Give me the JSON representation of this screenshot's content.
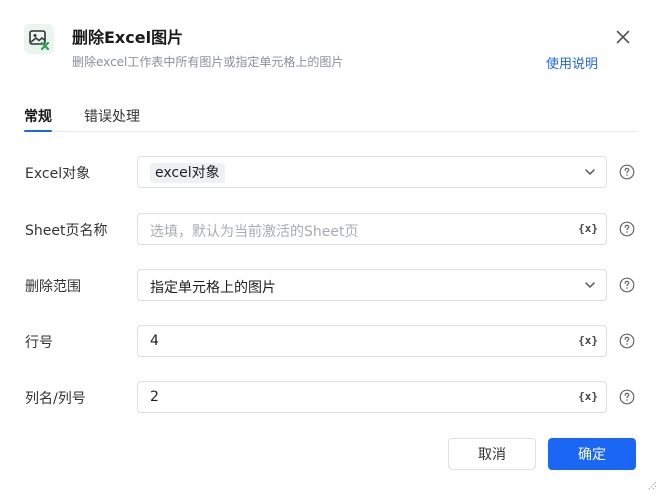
{
  "header": {
    "title": "删除Excel图片",
    "subtitle": "删除excel工作表中所有图片或指定单元格上的图片",
    "help_link": "使用说明",
    "icon": "excel-image-delete-icon"
  },
  "tabs": [
    {
      "label": "常规",
      "active": true
    },
    {
      "label": "错误处理",
      "active": false
    }
  ],
  "form": {
    "excel_object": {
      "label": "Excel对象",
      "value": "excel对象",
      "type": "select"
    },
    "sheet_name": {
      "label": "Sheet页名称",
      "placeholder": "选填，默认为当前激活的Sheet页",
      "value": "",
      "type": "input"
    },
    "delete_scope": {
      "label": "删除范围",
      "value": "指定单元格上的图片",
      "type": "select"
    },
    "row_number": {
      "label": "行号",
      "value": "4",
      "type": "input"
    },
    "column": {
      "label": "列名/列号",
      "value": "2",
      "type": "input"
    }
  },
  "var_button_label": "{x}",
  "footer": {
    "cancel_label": "取消",
    "ok_label": "确定"
  },
  "colors": {
    "accent": "#1a66f5",
    "link": "#1a66e8",
    "icon_green": "#2e9d5b"
  }
}
